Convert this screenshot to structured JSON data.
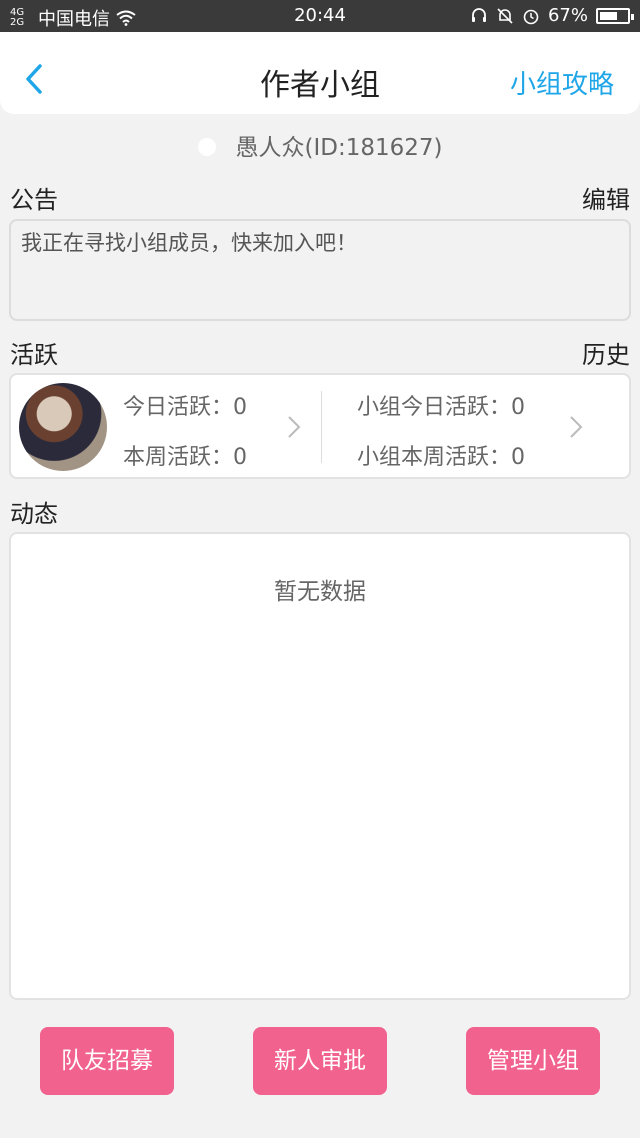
{
  "status_bar": {
    "signal": "4G 2G",
    "carrier": "中国电信",
    "time": "20:44",
    "battery_percent": "67%",
    "battery_level": 0.67
  },
  "header": {
    "title": "作者小组",
    "guide_link": "小组攻略"
  },
  "owner": "愚人众(ID:181627)",
  "notice": {
    "label": "公告",
    "edit_label": "编辑",
    "text": "我正在寻找小组成员，快来加入吧！"
  },
  "activity": {
    "label": "活跃",
    "history_label": "历史",
    "today": "今日活跃：0",
    "week": "本周活跃：0",
    "group_today": "小组今日活跃：0",
    "group_week": "小组本周活跃：0"
  },
  "feed": {
    "label": "动态",
    "empty_text": "暂无数据"
  },
  "buttons": {
    "recruit": "队友招募",
    "approve": "新人审批",
    "manage": "管理小组"
  },
  "colors": {
    "accent_blue": "#1ea6e8",
    "button_pink": "#f2628f"
  },
  "icons": [
    "signal-icon",
    "wifi-icon",
    "headset-icon",
    "mute-bell-icon",
    "alarm-icon",
    "battery-icon",
    "back-arrow-icon",
    "group-icon",
    "chevron-right-icon"
  ]
}
